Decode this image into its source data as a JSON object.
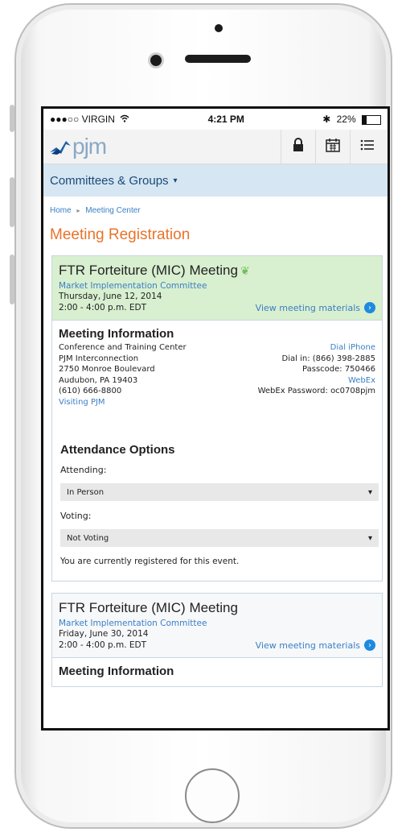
{
  "status_bar": {
    "signal": "●●●○○ VIRGIN",
    "wifi": "wifi-icon",
    "time": "4:21 PM",
    "bluetooth": "bluetooth-icon",
    "battery": "22%"
  },
  "header": {
    "logo_text": "pjm",
    "icons": [
      "lock-icon",
      "calendar-icon",
      "menu-icon"
    ]
  },
  "nav": {
    "label": "Committees & Groups",
    "caret": "▾"
  },
  "breadcrumb": {
    "home": "Home",
    "current": "Meeting Center"
  },
  "page_title": "Meeting Registration",
  "meetings": [
    {
      "title": "FTR Forteiture (MIC) Meeting",
      "committee": "Market Implementation Committee",
      "date": "Thursday, June 12, 2014",
      "time": "2:00 - 4:00 p.m. EDT",
      "materials_link": "View meeting materials",
      "info": {
        "heading": "Meeting Information",
        "address": [
          "Conference and Training Center",
          "PJM Interconnection",
          "2750 Monroe Boulevard",
          "Audubon, PA 19403",
          "(610) 666-8800"
        ],
        "visiting_link": "Visiting PJM",
        "dial_link": "Dial iPhone",
        "dial_in": "Dial in: (866) 398-2885",
        "passcode": "Passcode: 750466",
        "webex_link": "WebEx",
        "webex_password": "WebEx Password: oc0708pjm"
      },
      "attendance": {
        "heading": "Attendance Options",
        "attending_label": "Attending:",
        "attending_value": "In Person",
        "voting_label": "Voting:",
        "voting_value": "Not Voting",
        "notice": "You are currently registered for this event."
      }
    },
    {
      "title": "FTR Forteiture (MIC) Meeting",
      "committee": "Market Implementation Committee",
      "date": "Friday, June 30, 2014",
      "time": "2:00 - 4:00 p.m. EDT",
      "materials_link": "View meeting materials",
      "info_heading": "Meeting Information"
    }
  ]
}
